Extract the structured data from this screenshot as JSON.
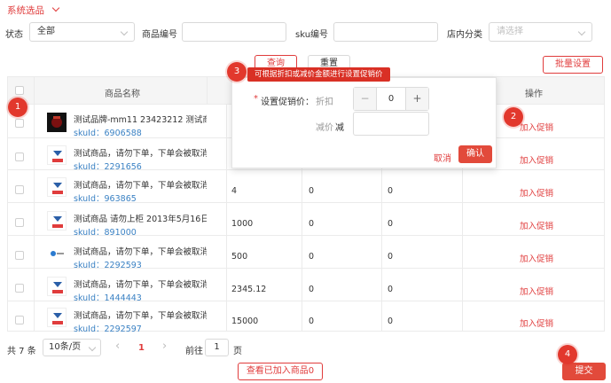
{
  "header": {
    "title": "系统选品"
  },
  "filters": {
    "status_label": "状态",
    "status_value": "全部",
    "product_code_label": "商品编号",
    "product_code_value": "",
    "sku_code_label": "sku编号",
    "sku_code_value": "",
    "category_label": "店内分类",
    "category_placeholder": "请选择"
  },
  "toolbar": {
    "query_label": "查询",
    "reset_label": "重置",
    "batch_label": "批量设置"
  },
  "table": {
    "col_name": "商品名称",
    "col_action": "操作",
    "rows": [
      {
        "name": "测试品牌-mm11 23423212 测试商...",
        "sku": "skuId：6906588",
        "price": "",
        "c2": "",
        "c3": "",
        "action": "加入促销"
      },
      {
        "name": "测试商品，请勿下单，下单会被取消订...",
        "sku": "skuId：2291656",
        "price": "",
        "c2": "",
        "c3": "",
        "action": "加入促销"
      },
      {
        "name": "测试商品，请勿下单，下单会被取消订...",
        "sku": "skuId：963865",
        "price": "4",
        "c2": "0",
        "c3": "0",
        "action": "加入促销"
      },
      {
        "name": "测试商品 请勿上柜 2013年5月16日2...",
        "sku": "skuId：891000",
        "price": "1000",
        "c2": "0",
        "c3": "0",
        "action": "加入促销"
      },
      {
        "name": "测试商品，请勿下单，下单会被取消订...",
        "sku": "skuId：2292593",
        "price": "500",
        "c2": "0",
        "c3": "0",
        "action": "加入促销"
      },
      {
        "name": "测试商品，请勿下单，下单会被取消订...",
        "sku": "skuId：1444443",
        "price": "2345.12",
        "c2": "0",
        "c3": "0",
        "action": "加入促销"
      },
      {
        "name": "测试商品，请勿下单，下单会被取消订...",
        "sku": "skuId：2292597",
        "price": "15000",
        "c2": "0",
        "c3": "0",
        "action": "加入促销"
      }
    ]
  },
  "popover": {
    "tip": "可根据折扣或减价金额进行设置促销价",
    "label_required": "*",
    "label": "设置促销价：",
    "discount_label": "折扣",
    "stepper_value": "0",
    "minus": "−",
    "plus": "+",
    "reduce_label": "减价",
    "reduce_unit": "减",
    "cancel": "取消",
    "confirm": "确认"
  },
  "pagination": {
    "total": "共 7 条",
    "page_size": "10条/页",
    "prev": "‹",
    "current": "1",
    "next": "›",
    "goto_label": "前往",
    "goto_value": "1",
    "goto_suffix": "页"
  },
  "footer": {
    "view_added": "查看已加入商品0",
    "submit": "提交"
  },
  "markers": [
    "1",
    "2",
    "3",
    "4"
  ],
  "colors": {
    "accent": "#e03c3c",
    "link": "#3b82c4"
  }
}
